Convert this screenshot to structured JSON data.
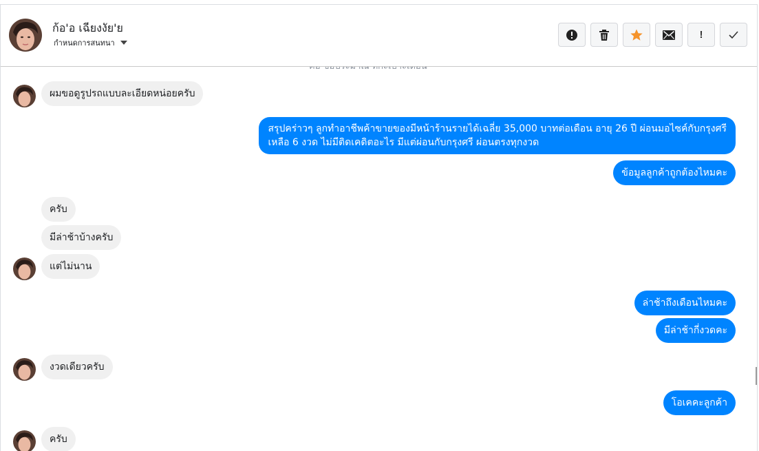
{
  "header": {
    "name": "ก้อ'อ เฉียงงัย'ย",
    "assign_label": "กำหนดการสนทนา"
  },
  "toolbar": {
    "buttons": [
      {
        "icon": "alert-circle-icon"
      },
      {
        "icon": "trash-icon"
      },
      {
        "icon": "star-icon"
      },
      {
        "icon": "envelope-icon"
      },
      {
        "icon": "exclamation-icon",
        "label": "!"
      },
      {
        "icon": "check-icon"
      }
    ],
    "star_color": "#f5932b"
  },
  "thread": {
    "cut_text": "ค่อ ขอประมาณ ทกะเบาะเดือน",
    "messages": [
      {
        "from": "customer",
        "text": "ผมขอดูรูปรถแบบละเอียดหน่อยครับ"
      },
      {
        "from": "agent",
        "lines": [
          "สรุปคร่าวๆ ลูกทำอาชีพค้าขายของมีหน้าร้านรายได้เฉลี่ย 35,000 บาทต่อเดือน อายุ 26 ปี ผ่อนมอไซค์กับกรุงศรี",
          "เหลือ 6 งวด ไม่มีติดเคดิตอะไร มีแต่ผ่อนกับกรุงศรี ผ่อนตรงทุกงวด"
        ]
      },
      {
        "from": "agent",
        "text": "ข้อมูลลูกค้าถูกต้องไหมคะ"
      },
      {
        "from": "customer",
        "text": "ครับ"
      },
      {
        "from": "customer",
        "text": "มีล่าช้าบ้างครับ"
      },
      {
        "from": "customer",
        "text": "แต่ไม่นาน"
      },
      {
        "from": "agent",
        "text": "ล่าช้าถึงเดือนไหมคะ"
      },
      {
        "from": "agent",
        "text": "มีล่าช้ากี่งวดคะ"
      },
      {
        "from": "customer",
        "text": "งวดเดียวครับ"
      },
      {
        "from": "agent",
        "text": "โอเคคะลูกค้า"
      },
      {
        "from": "customer",
        "text": "ครับ"
      }
    ]
  },
  "colors": {
    "outgoing_bubble": "#0084ff",
    "incoming_bubble": "#f0f0f0"
  }
}
